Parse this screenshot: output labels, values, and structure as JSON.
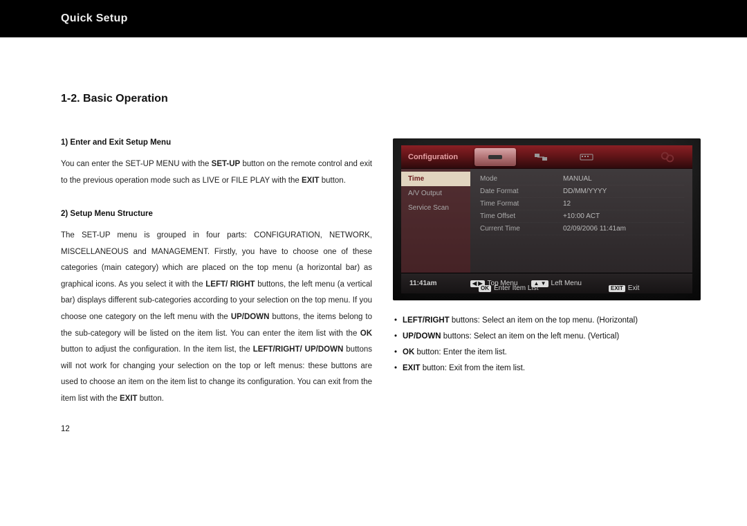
{
  "header": {
    "title": "Quick Setup"
  },
  "section": {
    "title": "1-2. Basic Operation"
  },
  "left": {
    "sub1_heading": "1) Enter and Exit Setup Menu",
    "sub1_leadA": "You can enter the SET-UP MENU with the ",
    "sub1_bold1": "SET-UP",
    "sub1_mid": " button on the remote control and exit to the previous operation mode such as LIVE or FILE PLAY with the ",
    "sub1_bold2": "EXIT",
    "sub1_tail": " button.",
    "sub2_heading": "2) Setup Menu Structure",
    "sub2_p1": "The SET-UP menu is grouped in four parts: CONFIGURATION, NETWORK, MISCELLANEOUS and MANAGEMENT. Firstly, you have to choose one of these categories (main category) which are placed on the top menu (a horizontal bar) as graphical icons. As you select it with the ",
    "sub2_b1": "LEFT/ RIGHT",
    "sub2_p2": " buttons, the left menu (a vertical bar) displays different sub-categories according to your selection on the top menu. If you choose one category on the left menu with the ",
    "sub2_b2": "UP/DOWN",
    "sub2_p3": " buttons, the items belong to the sub-category will be listed on the item list. You can enter the item list with the ",
    "sub2_b3": "OK",
    "sub2_p4": " button to adjust the configuration. In the item list, the ",
    "sub2_b4": "LEFT/RIGHT/ UP/DOWN",
    "sub2_p5": " buttons will not work for changing your selection on the top or left menus: these buttons are used to choose an item on the item list to change its configuration. You can exit from the item list with the ",
    "sub2_b5": "EXIT",
    "sub2_p6": " button.",
    "page_number": "12"
  },
  "screenshot": {
    "config_label": "Configuration",
    "leftmenu": {
      "time": "Time",
      "av": "A/V Output",
      "scan": "Service Scan"
    },
    "rows": [
      {
        "k": "Mode",
        "v": "MANUAL"
      },
      {
        "k": "Date Format",
        "v": "DD/MM/YYYY"
      },
      {
        "k": "Time Format",
        "v": "12"
      },
      {
        "k": "Time Offset",
        "v": "+10:00 ACT"
      },
      {
        "k": "Current Time",
        "v": "02/09/2006 11:41am"
      }
    ],
    "clock": "11:41am",
    "hint_topmenu_key": "◀ ▶",
    "hint_topmenu": "Top Menu",
    "hint_leftmenu_key": "▲ ▼",
    "hint_leftmenu": "Left Menu",
    "hint_enter_key": "OK",
    "hint_enter": "Enter Item List",
    "hint_exit_key": "EXIT",
    "hint_exit": "Exit"
  },
  "bullets": {
    "b1_bold": "LEFT/RIGHT",
    "b1_rest": " buttons: Select an item on the top menu. (Horizontal)",
    "b2_bold": "UP/DOWN",
    "b2_rest": " buttons: Select an item on the left menu. (Vertical)",
    "b3_bold": "OK",
    "b3_rest": " button: Enter the item list.",
    "b4_bold": "EXIT",
    "b4_rest": " button: Exit from the item list."
  }
}
